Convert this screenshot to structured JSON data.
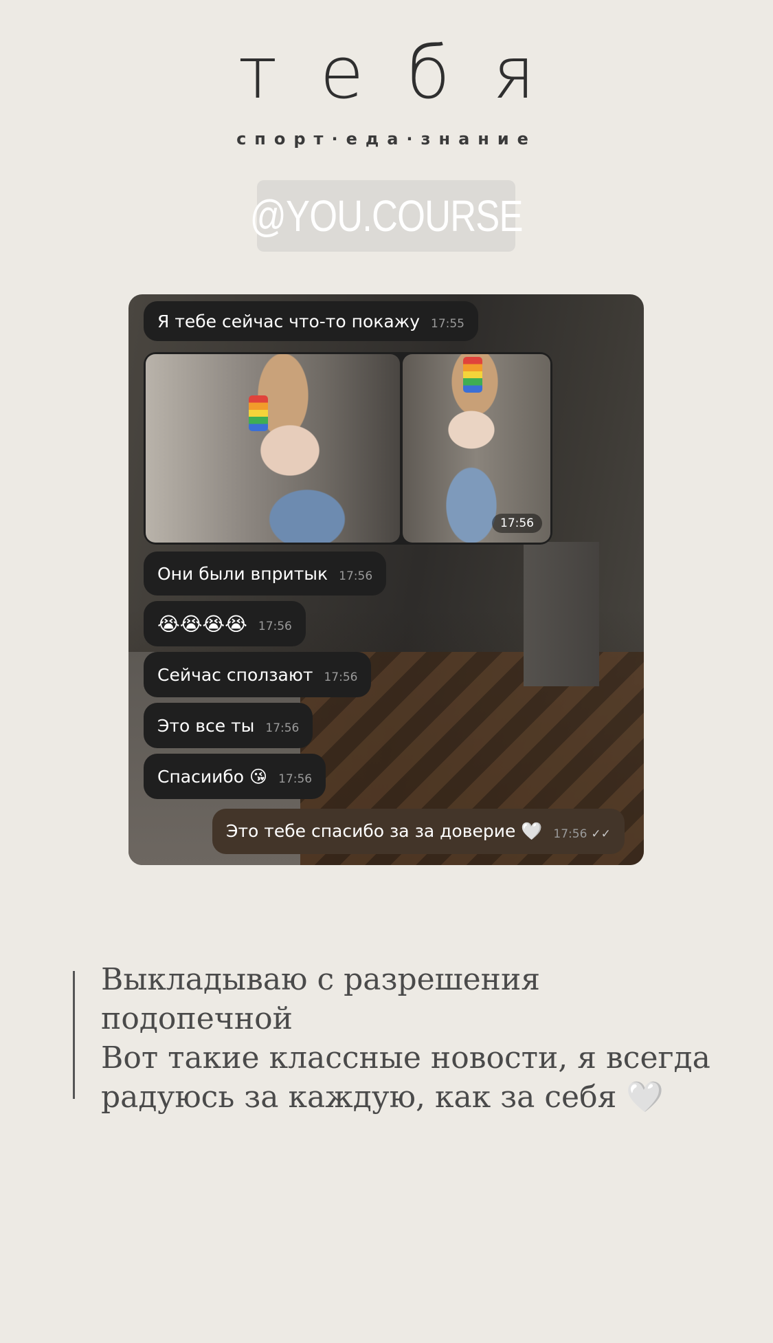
{
  "logo": {
    "text": "тебя",
    "tagline": "спорт·еда·знание"
  },
  "handle": "@YOU.COURSE",
  "chat": {
    "messages": [
      {
        "text": "Я тебе сейчас что-то покажу",
        "time": "17:55"
      },
      {
        "type": "photos",
        "time": "17:56"
      },
      {
        "text": "Они были впритык",
        "time": "17:56"
      },
      {
        "text": "😭😭😭😭",
        "time": "17:56"
      },
      {
        "text": "Сейчас сползают",
        "time": "17:56"
      },
      {
        "text": "Это все ты",
        "time": "17:56"
      },
      {
        "text": "Спасиибо 😘",
        "time": "17:56"
      },
      {
        "text": "Это тебе спасибо за за доверие 🤍",
        "time": "17:56",
        "status": "✓✓"
      }
    ]
  },
  "caption": {
    "lines": [
      "Выкладываю с разрешения",
      "подопечной",
      "Вот такие классные новости, я всегда",
      "радуюсь за каждую, как за себя 🤍"
    ]
  },
  "colors": {
    "background": "#edeae4",
    "bubble_in": "#1f1f1f",
    "bubble_out": "#433529"
  }
}
